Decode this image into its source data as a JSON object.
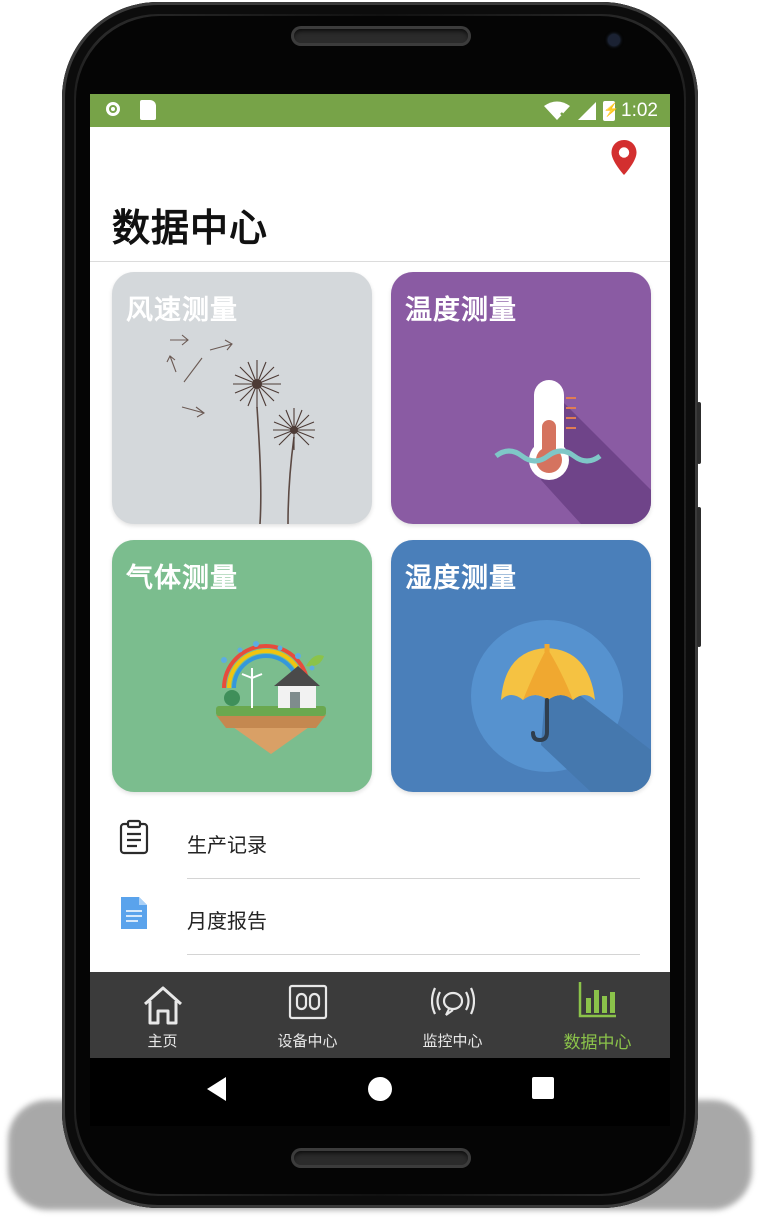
{
  "status_bar": {
    "time": "1:02"
  },
  "header": {
    "title": "数据中心",
    "location_icon": "location-pin-icon"
  },
  "cards": [
    {
      "title": "风速测量",
      "color": "#d4d8db",
      "icon": "dandelion-icon"
    },
    {
      "title": "温度测量",
      "color": "#8a5ba3",
      "icon": "thermometer-icon"
    },
    {
      "title": "气体测量",
      "color": "#7bbd8e",
      "icon": "eco-house-icon"
    },
    {
      "title": "湿度测量",
      "color": "#4a7fba",
      "icon": "umbrella-icon"
    }
  ],
  "list": [
    {
      "label": "生产记录",
      "icon": "clipboard-icon"
    },
    {
      "label": "月度报告",
      "icon": "document-icon"
    }
  ],
  "bottom_nav": [
    {
      "label": "主页",
      "icon": "home-icon",
      "active": false
    },
    {
      "label": "设备中心",
      "icon": "device-icon",
      "active": false
    },
    {
      "label": "监控中心",
      "icon": "monitor-broadcast-icon",
      "active": false
    },
    {
      "label": "数据中心",
      "icon": "bar-chart-icon",
      "active": true
    }
  ],
  "colors": {
    "status_bar": "#77a348",
    "nav_background": "#3b3b3b",
    "nav_active": "#8bc34a",
    "location_pin": "#d32f2f"
  }
}
